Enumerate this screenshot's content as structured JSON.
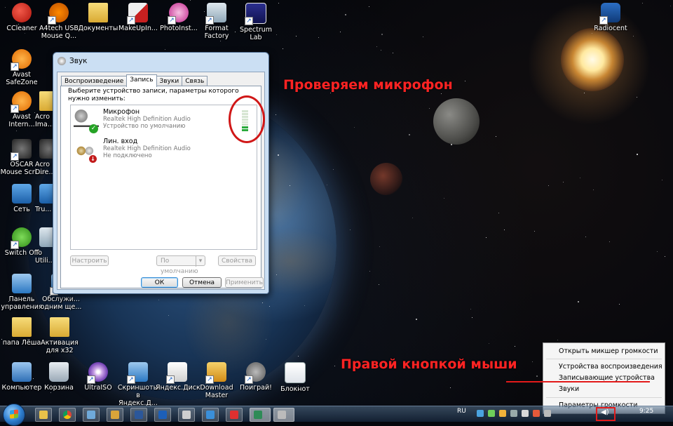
{
  "desktop": {
    "icons": [
      {
        "label": "CCleaner"
      },
      {
        "label": "A4tech USB Mouse Q..."
      },
      {
        "label": "Документы"
      },
      {
        "label": "MakeUpIn..."
      },
      {
        "label": "PhotoInst..."
      },
      {
        "label": "Format Factory"
      },
      {
        "label": "Spectrum Lab"
      },
      {
        "label": "Avast SafeZone"
      },
      {
        "label": "Avast Intern..."
      },
      {
        "label": "Acro Ima..."
      },
      {
        "label": "OSCAR Mouse Scri..."
      },
      {
        "label": "Acro Dire..."
      },
      {
        "label": "Сеть"
      },
      {
        "label": "Tru..."
      },
      {
        "label": "Switch Off"
      },
      {
        "label": "To Utili..."
      },
      {
        "label": "Панель управления"
      },
      {
        "label": "Обслужи... одним щe..."
      },
      {
        "label": "папа Лёша"
      },
      {
        "label": "Активация для x32"
      },
      {
        "label": "Компьютер"
      },
      {
        "label": "Корзина"
      },
      {
        "label": "UltraISO"
      },
      {
        "label": "Скриншоты в Яндекс.Д..."
      },
      {
        "label": "Яндекс.Диск"
      },
      {
        "label": "Download Master"
      },
      {
        "label": "Поиграй!"
      },
      {
        "label": "Блокнот"
      },
      {
        "label": "Radiocent"
      }
    ]
  },
  "annotations": {
    "check_mic": "Проверяем микрофон",
    "right_click": "Правой кнопкой мыши"
  },
  "sound_dialog": {
    "title": "Звук",
    "tabs": [
      "Воспроизведение",
      "Запись",
      "Звуки",
      "Связь"
    ],
    "active_tab": "Запись",
    "instruction": "Выберите устройство записи, параметры которого нужно изменить:",
    "devices": [
      {
        "name": "Микрофон",
        "driver": "Realtek High Definition Audio",
        "status": "Устройство по умолчанию",
        "level_fraction": 0.3
      },
      {
        "name": "Лин. вход",
        "driver": "Realtek High Definition Audio",
        "status": "Не подключено"
      }
    ],
    "buttons": {
      "configure": "Настроить",
      "default": "По умолчанию",
      "properties": "Свойства",
      "ok": "ОК",
      "cancel": "Отмена",
      "apply": "Применить"
    }
  },
  "context_menu": {
    "items": [
      "Открыть микшер громкости",
      "Устройства воспроизведения",
      "Записывающие устройства",
      "Звуки",
      "Параметры громкости"
    ],
    "highlighted": "Записывающие устройства"
  },
  "taskbar": {
    "language": "RU",
    "time": "9:25"
  },
  "colors": {
    "annotation_red": "#ff2323",
    "dialog_frame": "#cbdff3",
    "level_green": "#2aaa3c"
  }
}
